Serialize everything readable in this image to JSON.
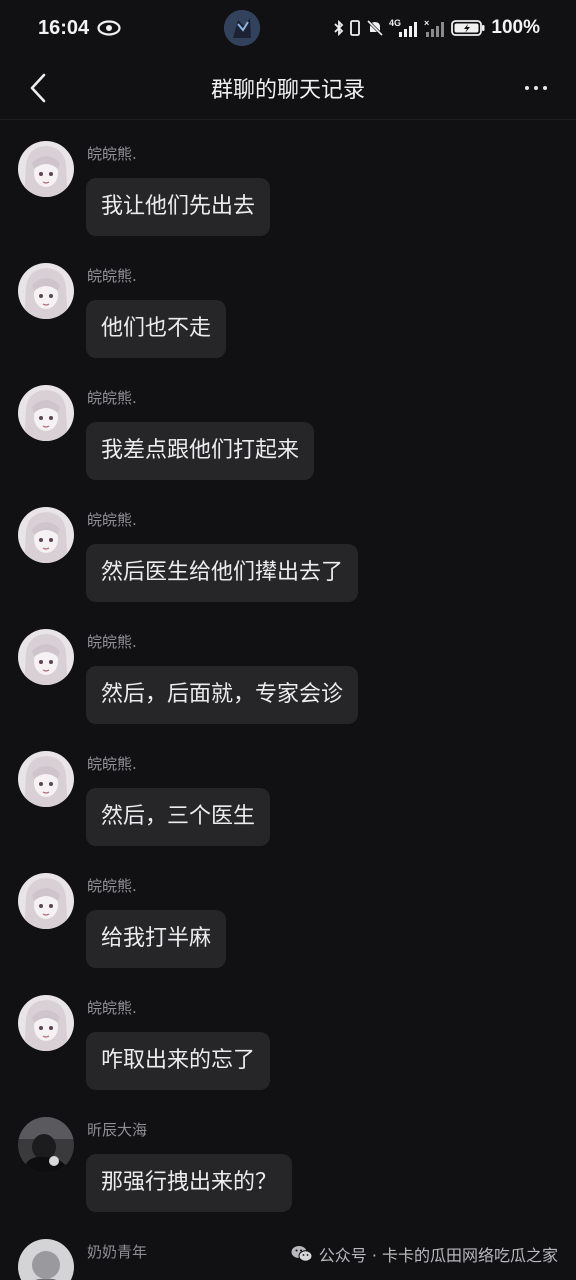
{
  "status": {
    "time": "16:04",
    "battery": "100%",
    "network": "4G",
    "icons": [
      "eye-icon",
      "bluetooth-icon",
      "vibrate-icon",
      "mute-icon",
      "signal-icon",
      "battery-icon"
    ]
  },
  "nav": {
    "back_icon": "chevron-left-icon",
    "title": "群聊的聊天记录",
    "more_icon": "more-icon"
  },
  "messages": [
    {
      "sender": "皖皖熊.",
      "text": "我让他们先出去",
      "avatar": "anime-girl"
    },
    {
      "sender": "皖皖熊.",
      "text": "他们也不走",
      "avatar": "anime-girl"
    },
    {
      "sender": "皖皖熊.",
      "text": "我差点跟他们打起来",
      "avatar": "anime-girl"
    },
    {
      "sender": "皖皖熊.",
      "text": "然后医生给他们撵出去了",
      "avatar": "anime-girl"
    },
    {
      "sender": "皖皖熊.",
      "text": "然后，后面就，专家会诊",
      "avatar": "anime-girl"
    },
    {
      "sender": "皖皖熊.",
      "text": "然后，三个医生",
      "avatar": "anime-girl"
    },
    {
      "sender": "皖皖熊.",
      "text": "给我打半麻",
      "avatar": "anime-girl"
    },
    {
      "sender": "皖皖熊.",
      "text": "咋取出来的忘了",
      "avatar": "anime-girl"
    },
    {
      "sender": "昕辰大海",
      "text": "那强行拽出来的？",
      "avatar": "dark-portrait"
    },
    {
      "sender": "奶奶青年",
      "text": "",
      "avatar": "gray-portrait"
    }
  ],
  "watermark": {
    "icon": "wechat-icon",
    "text": "公众号 · 卡卡的瓜田网络吃瓜之家"
  }
}
